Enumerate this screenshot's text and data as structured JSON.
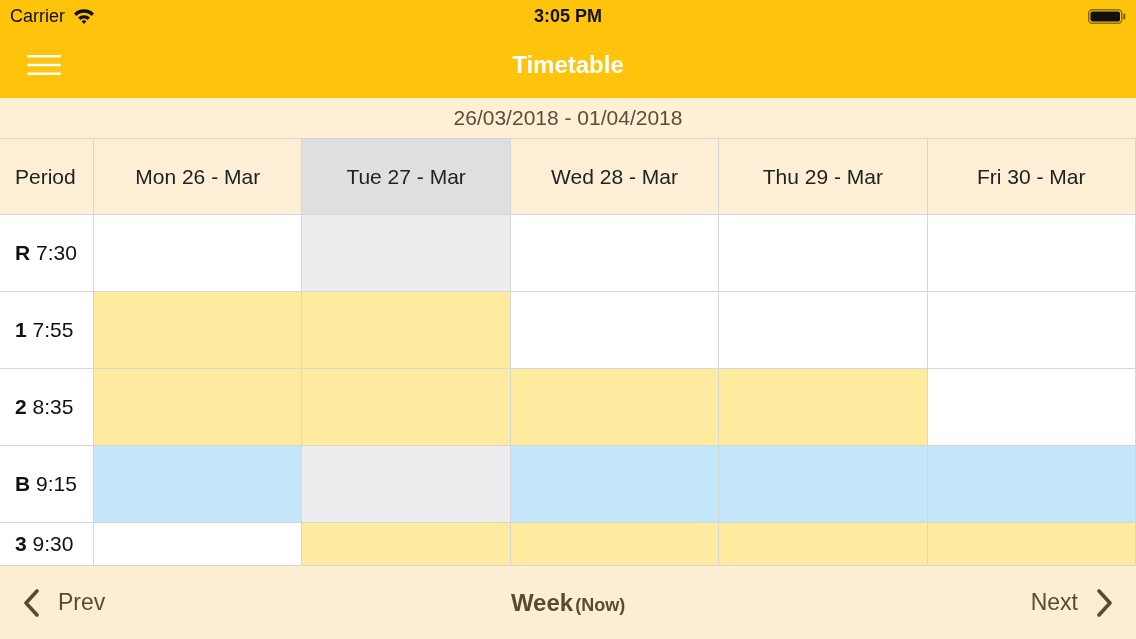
{
  "status_bar": {
    "carrier": "Carrier",
    "time": "3:05 PM"
  },
  "nav_bar": {
    "title": "Timetable"
  },
  "date_range": "26/03/2018 - 01/04/2018",
  "timetable": {
    "corner_label": "Period",
    "days": [
      {
        "label": "Mon 26 - Mar",
        "today": false
      },
      {
        "label": "Tue 27 - Mar",
        "today": true
      },
      {
        "label": "Wed 28 - Mar",
        "today": false
      },
      {
        "label": "Thu 29 - Mar",
        "today": false
      },
      {
        "label": "Fri 30 - Mar",
        "today": false
      }
    ],
    "rows": [
      {
        "period": "**R** 7:30",
        "cells": [
          {
            "kind": "free"
          },
          {
            "kind": "free"
          },
          {
            "kind": "free"
          },
          {
            "kind": "free"
          },
          {
            "kind": "free"
          }
        ]
      },
      {
        "period": "**1** 7:55",
        "cells": [
          {
            "kind": "lesson"
          },
          {
            "kind": "lesson"
          },
          {
            "kind": "free"
          },
          {
            "kind": "free"
          },
          {
            "kind": "free"
          }
        ]
      },
      {
        "period": "**2** 8:35",
        "cells": [
          {
            "kind": "lesson"
          },
          {
            "kind": "lesson"
          },
          {
            "kind": "lesson"
          },
          {
            "kind": "lesson"
          },
          {
            "kind": "free"
          }
        ]
      },
      {
        "period": "**B** 9:15",
        "cells": [
          {
            "kind": "break"
          },
          {
            "kind": "free"
          },
          {
            "kind": "break"
          },
          {
            "kind": "break"
          },
          {
            "kind": "break"
          }
        ]
      },
      {
        "period": "**3** 9:30",
        "cells": [
          {
            "kind": "free"
          },
          {
            "kind": "lesson"
          },
          {
            "kind": "lesson"
          },
          {
            "kind": "lesson"
          },
          {
            "kind": "lesson"
          }
        ]
      }
    ]
  },
  "bottom_bar": {
    "prev": "Prev",
    "title": "Week",
    "subtitle": "(Now)",
    "next": "Next"
  }
}
